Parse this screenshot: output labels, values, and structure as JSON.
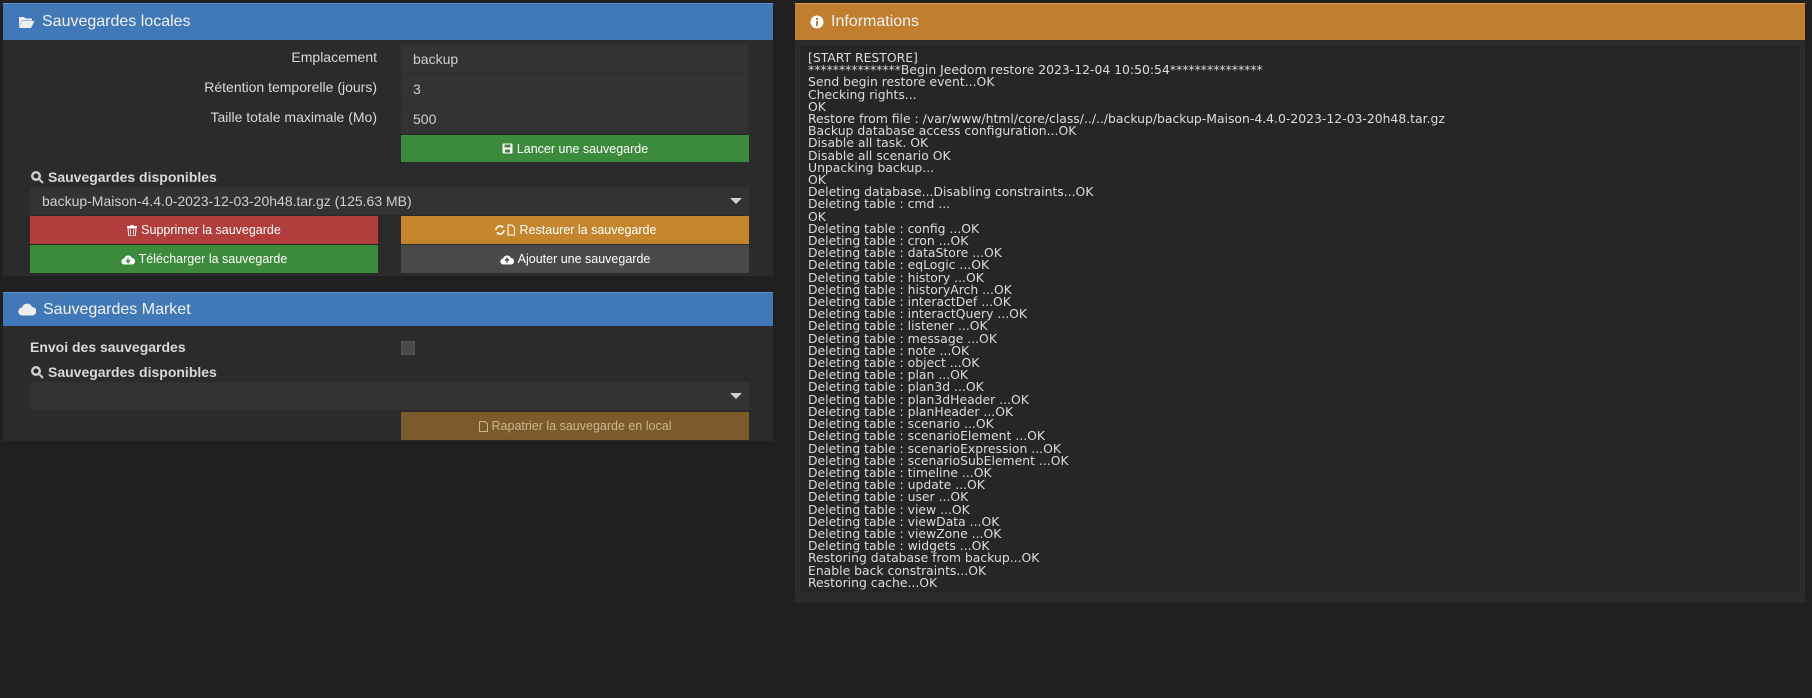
{
  "local": {
    "title": "Sauvegardes locales",
    "fields": [
      {
        "label": "Emplacement",
        "value": "backup"
      },
      {
        "label": "Rétention temporelle (jours)",
        "value": "3"
      },
      {
        "label": "Taille totale maximale (Mo)",
        "value": "500"
      }
    ],
    "launch_label": "Lancer une sauvegarde",
    "available_label": "Sauvegardes disponibles",
    "selected_backup": "backup-Maison-4.4.0-2023-12-03-20h48.tar.gz (125.63 MB)",
    "delete_label": "Supprimer la sauvegarde",
    "restore_label": "Restaurer la sauvegarde",
    "download_label": "Télécharger la sauvegarde",
    "add_label": "Ajouter une sauvegarde"
  },
  "market": {
    "title": "Sauvegardes Market",
    "send_label": "Envoi des sauvegardes",
    "send_checked": false,
    "available_label": "Sauvegardes disponibles",
    "selected_backup": "",
    "repatriate_label": "Rapatrier la sauvegarde en local"
  },
  "info": {
    "title": "Informations",
    "log_lines": [
      "[START RESTORE]",
      "***************Begin Jeedom restore 2023-12-04 10:50:54***************",
      "Send begin restore event...OK",
      "Checking rights...",
      "OK",
      "Restore from file : /var/www/html/core/class/../../backup/backup-Maison-4.4.0-2023-12-03-20h48.tar.gz",
      "Backup database access configuration...OK",
      "Disable all task. OK",
      "Disable all scenario OK",
      "Unpacking backup...",
      "OK",
      "Deleting database...Disabling constraints...OK",
      "Deleting table : cmd ...",
      "OK",
      "Deleting table : config ...OK",
      "Deleting table : cron ...OK",
      "Deleting table : dataStore ...OK",
      "Deleting table : eqLogic ...OK",
      "Deleting table : history ...OK",
      "Deleting table : historyArch ...OK",
      "Deleting table : interactDef ...OK",
      "Deleting table : interactQuery ...OK",
      "Deleting table : listener ...OK",
      "Deleting table : message ...OK",
      "Deleting table : note ...OK",
      "Deleting table : object ...OK",
      "Deleting table : plan ...OK",
      "Deleting table : plan3d ...OK",
      "Deleting table : plan3dHeader ...OK",
      "Deleting table : planHeader ...OK",
      "Deleting table : scenario ...OK",
      "Deleting table : scenarioElement ...OK",
      "Deleting table : scenarioExpression ...OK",
      "Deleting table : scenarioSubElement ...OK",
      "Deleting table : timeline ...OK",
      "Deleting table : update ...OK",
      "Deleting table : user ...OK",
      "Deleting table : view ...OK",
      "Deleting table : viewData ...OK",
      "Deleting table : viewZone ...OK",
      "Deleting table : widgets ...OK",
      "Restoring database from backup...OK",
      "Enable back constraints...OK",
      "Restoring cache...OK"
    ]
  },
  "colors": {
    "header_blue": "#4178b8",
    "header_orange": "#c07e2e",
    "success": "#3c8a3c",
    "danger": "#b13d3d",
    "warning": "#c5852d"
  },
  "icons": {
    "local_title": "folder-open-icon",
    "market_title": "cloud-icon",
    "info_title": "info-circle-icon",
    "launch": "save-icon",
    "available": "search-icon",
    "delete": "trash-icon",
    "restore": "refresh-file-icon",
    "download": "cloud-download-icon",
    "add": "cloud-upload-icon",
    "repatriate": "file-icon"
  }
}
